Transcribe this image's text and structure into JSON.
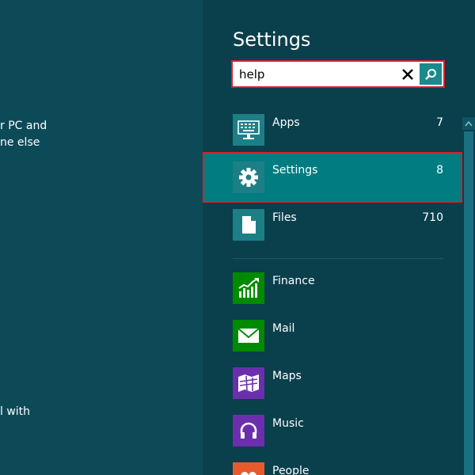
{
  "background_text": {
    "line1": "r PC and",
    "line2": "ne else",
    "line3": "l with"
  },
  "pane": {
    "title": "Settings"
  },
  "search": {
    "value": "help",
    "clear_icon": "close-icon",
    "search_icon": "search-icon"
  },
  "categories": [
    {
      "label": "Apps",
      "count": "7",
      "icon": "keyboard-icon",
      "selected": false
    },
    {
      "label": "Settings",
      "count": "8",
      "icon": "gear-icon",
      "selected": true
    },
    {
      "label": "Files",
      "count": "710",
      "icon": "file-icon",
      "selected": false
    }
  ],
  "apps": [
    {
      "label": "Finance",
      "icon": "finance-chart-icon",
      "color": "#008a00"
    },
    {
      "label": "Mail",
      "icon": "mail-envelope-icon",
      "color": "#008a00"
    },
    {
      "label": "Maps",
      "icon": "map-icon",
      "color": "#6b2fae"
    },
    {
      "label": "Music",
      "icon": "headphones-icon",
      "color": "#6b2fae"
    },
    {
      "label": "People",
      "icon": "people-icon",
      "color": "#e85a2c"
    }
  ],
  "colors": {
    "background": "#0d4a58",
    "pane": "#0a3f4c",
    "selected": "#017c80",
    "highlight_border": "#d8202e",
    "tile_teal": "#1c7f86"
  }
}
